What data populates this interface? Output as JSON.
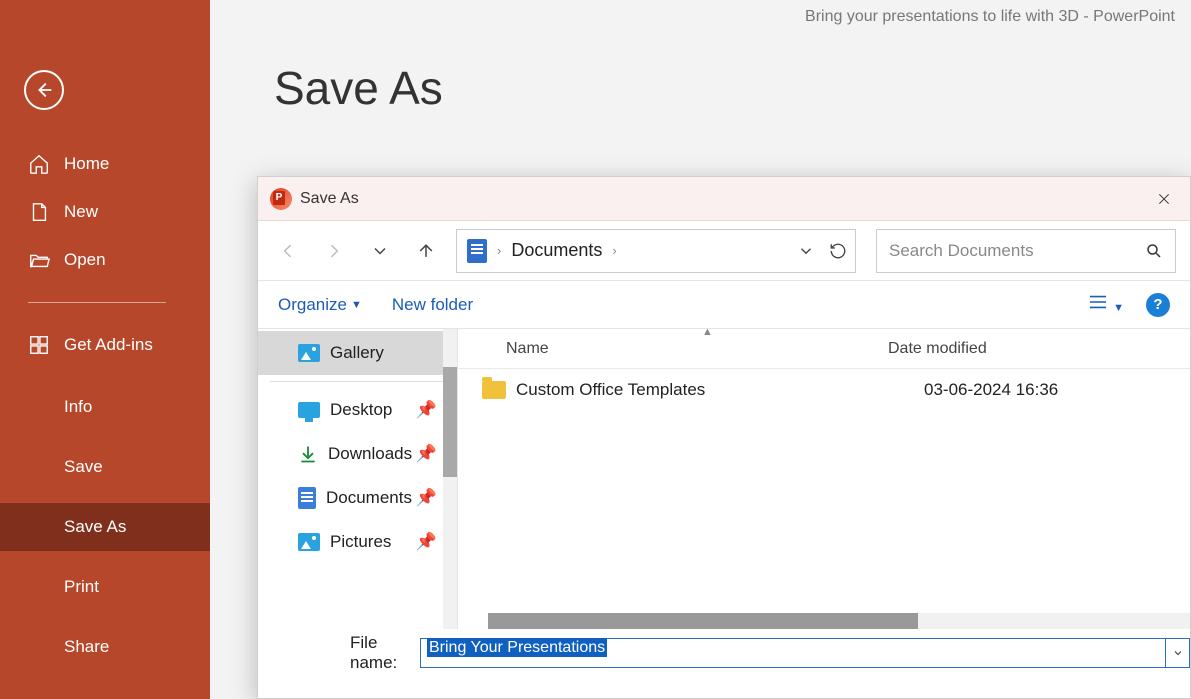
{
  "titlebar": {
    "doc": "Bring your presentations to life with 3D",
    "sep": "  -  ",
    "app": "PowerPoint"
  },
  "sidebar": {
    "home": "Home",
    "new": "New",
    "open": "Open",
    "addins": "Get Add-ins",
    "info": "Info",
    "save": "Save",
    "saveas": "Save As",
    "print": "Print",
    "share": "Share"
  },
  "page": {
    "title": "Save As"
  },
  "dialog": {
    "title": "Save As",
    "breadcrumb": {
      "location": "Documents"
    },
    "search_placeholder": "Search Documents",
    "organize": "Organize",
    "newfolder": "New folder",
    "places": {
      "gallery": "Gallery",
      "desktop": "Desktop",
      "downloads": "Downloads",
      "documents": "Documents",
      "pictures": "Pictures"
    },
    "columns": {
      "name": "Name",
      "date": "Date modified"
    },
    "rows": [
      {
        "name": "Custom Office Templates",
        "date": "03-06-2024 16:36"
      }
    ],
    "filename_label": "File name:",
    "filename_value": "Bring Your Presentations"
  }
}
